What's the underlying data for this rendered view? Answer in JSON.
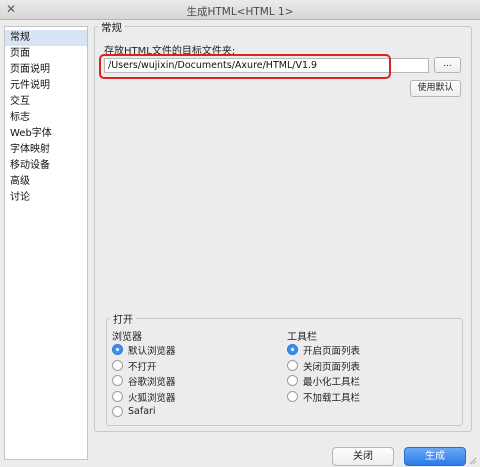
{
  "window": {
    "title": "生成HTML<HTML 1>",
    "close_icon": "close-x-icon"
  },
  "sidebar": {
    "items": [
      {
        "label": "常规",
        "selected": true
      },
      {
        "label": "页面",
        "selected": false
      },
      {
        "label": "页面说明",
        "selected": false
      },
      {
        "label": "元件说明",
        "selected": false
      },
      {
        "label": "交互",
        "selected": false
      },
      {
        "label": "标志",
        "selected": false
      },
      {
        "label": "Web字体",
        "selected": false
      },
      {
        "label": "字体映射",
        "selected": false
      },
      {
        "label": "移动设备",
        "selected": false
      },
      {
        "label": "高级",
        "selected": false
      },
      {
        "label": "讨论",
        "selected": false
      }
    ]
  },
  "general": {
    "section_title": "常规",
    "folder_label": "存放HTML文件的目标文件夹:",
    "folder_value": "/Users/wujixin/Documents/Axure/HTML/V1.9",
    "browse_label": "...",
    "use_default_label": "使用默认",
    "highlight_color": "#e02020"
  },
  "open": {
    "section_title": "打开",
    "browser": {
      "label": "浏览器",
      "options": [
        {
          "label": "默认浏览器",
          "checked": true
        },
        {
          "label": "不打开",
          "checked": false
        },
        {
          "label": "谷歌浏览器",
          "checked": false
        },
        {
          "label": "火狐浏览器",
          "checked": false
        },
        {
          "label": "Safari",
          "checked": false
        }
      ]
    },
    "toolbar": {
      "label": "工具栏",
      "options": [
        {
          "label": "开启页面列表",
          "checked": true
        },
        {
          "label": "关闭页面列表",
          "checked": false
        },
        {
          "label": "最小化工具栏",
          "checked": false
        },
        {
          "label": "不加载工具栏",
          "checked": false
        }
      ]
    }
  },
  "footer": {
    "close_label": "关闭",
    "generate_label": "生成",
    "accent_color": "#2a7be6"
  }
}
